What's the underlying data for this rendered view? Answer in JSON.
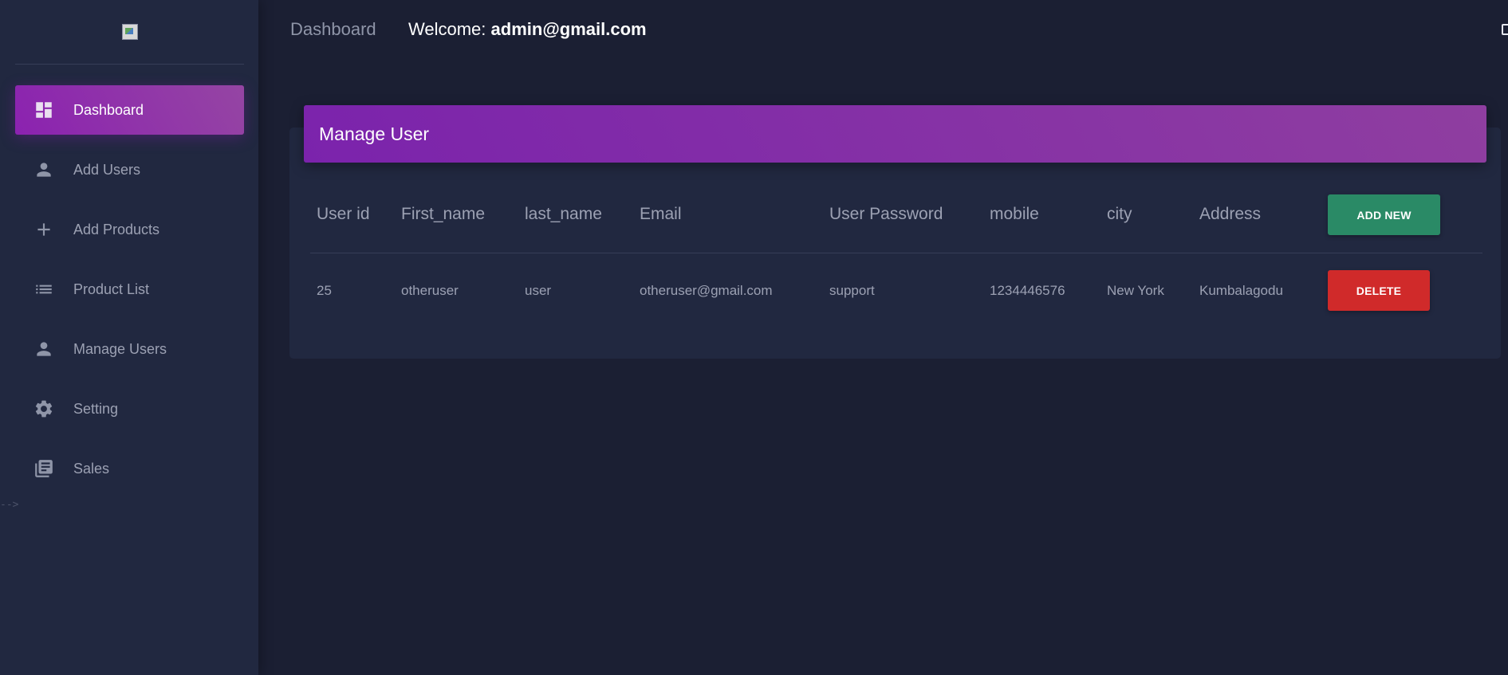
{
  "sidebar": {
    "items": [
      {
        "label": "Dashboard",
        "icon": "dashboard-icon",
        "active": true
      },
      {
        "label": "Add Users",
        "icon": "person-icon"
      },
      {
        "label": "Add Products",
        "icon": "plus-icon"
      },
      {
        "label": "Product List",
        "icon": "list-icon"
      },
      {
        "label": "Manage Users",
        "icon": "person-icon"
      },
      {
        "label": "Setting",
        "icon": "gear-icon"
      },
      {
        "label": "Sales",
        "icon": "library-books-icon"
      }
    ],
    "stray_text": "-->"
  },
  "topbar": {
    "title": "Dashboard",
    "welcome_prefix": "Welcome:",
    "welcome_user": "admin@gmail.com"
  },
  "card": {
    "title": "Manage User",
    "headers": [
      "User id",
      "First_name",
      "last_name",
      "Email",
      "User Password",
      "mobile",
      "city",
      "Address"
    ],
    "rows": [
      [
        "25",
        "otheruser",
        "user",
        "otheruser@gmail.com",
        "support",
        "1234446576",
        "New York",
        "Kumbalagodu"
      ]
    ],
    "add_new_label": "ADD NEW",
    "delete_label": "DELETE"
  },
  "colors": {
    "background": "#1b1f33",
    "sidebar": "#212840",
    "accent_purple": "#8b22b0",
    "add_button": "#2a8a66",
    "delete_button": "#d02a2a"
  }
}
